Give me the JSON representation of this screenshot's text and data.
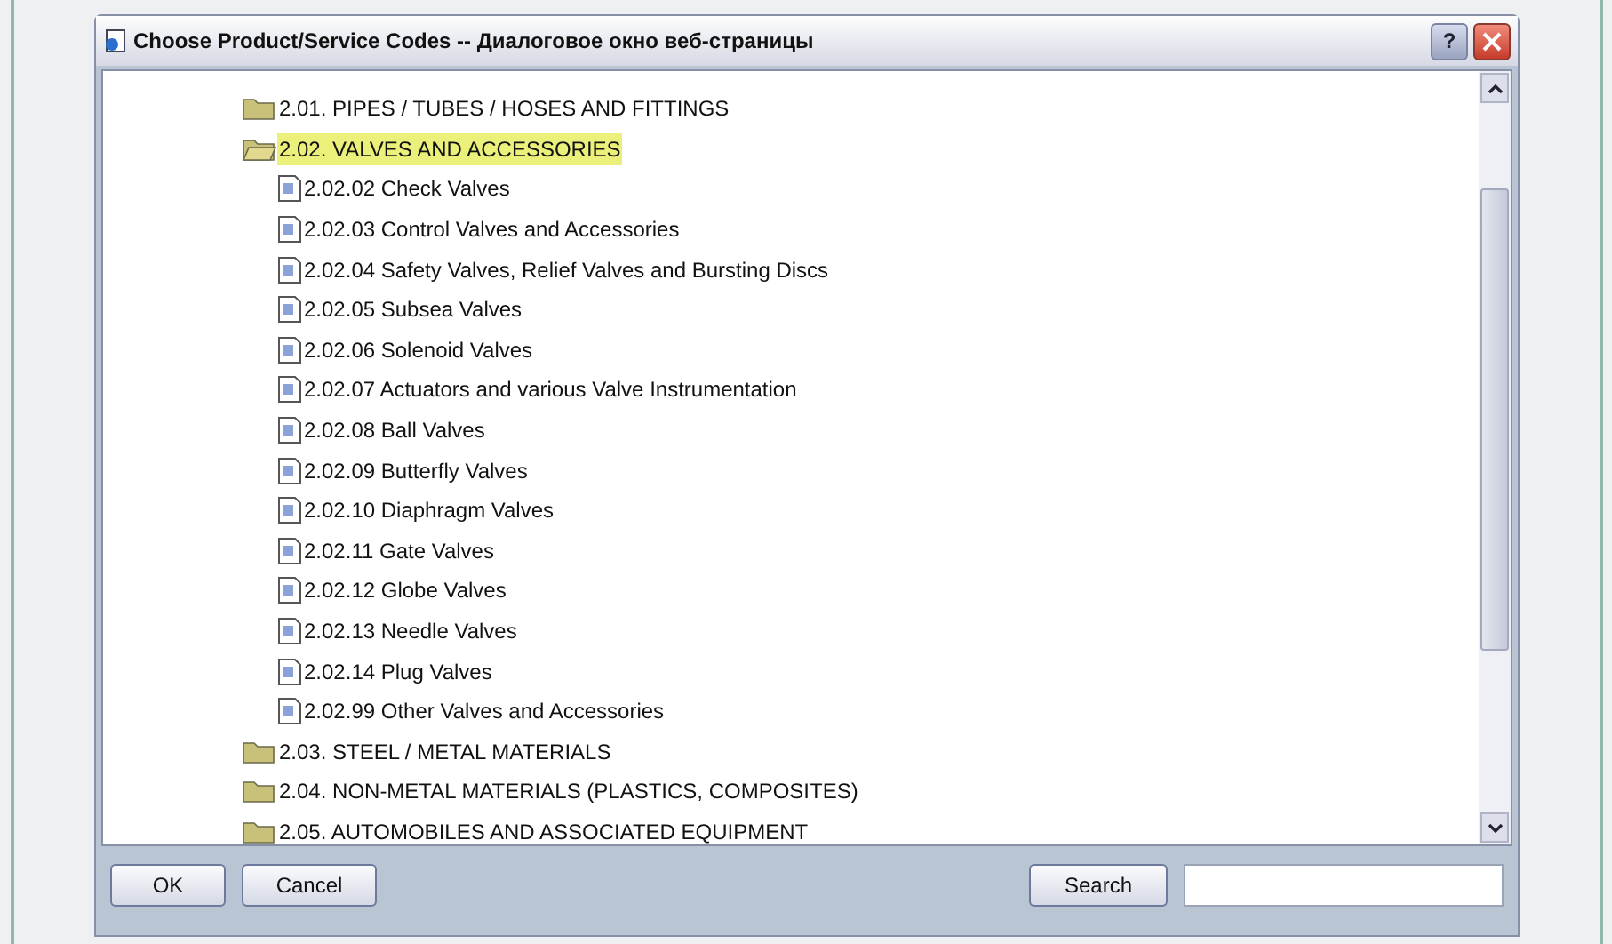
{
  "window": {
    "title": "Choose Product/Service Codes -- Диалоговое окно веб-страницы",
    "help": "?"
  },
  "tree": [
    {
      "label": "2.01. PIPES / TUBES / HOSES AND FITTINGS",
      "kind": "folder",
      "expanded": false,
      "selected": false
    },
    {
      "label": "2.02. VALVES AND ACCESSORIES",
      "kind": "folder",
      "expanded": true,
      "selected": true,
      "children": [
        {
          "label": "2.02.02 Check Valves",
          "kind": "doc",
          "selected": false
        },
        {
          "label": "2.02.03 Control Valves and Accessories",
          "kind": "doc",
          "selected": false
        },
        {
          "label": "2.02.04 Safety Valves, Relief Valves and Bursting Discs",
          "kind": "doc",
          "selected": false
        },
        {
          "label": "2.02.05 Subsea Valves",
          "kind": "doc",
          "selected": false
        },
        {
          "label": "2.02.06 Solenoid Valves",
          "kind": "doc",
          "selected": false
        },
        {
          "label": "2.02.07 Actuators and various Valve Instrumentation",
          "kind": "doc",
          "selected": false
        },
        {
          "label": "2.02.08 Ball Valves",
          "kind": "doc",
          "selected": false
        },
        {
          "label": "2.02.09 Butterfly Valves",
          "kind": "doc",
          "selected": false
        },
        {
          "label": "2.02.10 Diaphragm Valves",
          "kind": "doc",
          "selected": false
        },
        {
          "label": "2.02.11 Gate Valves",
          "kind": "doc",
          "selected": false
        },
        {
          "label": "2.02.12 Globe Valves",
          "kind": "doc",
          "selected": false
        },
        {
          "label": "2.02.13 Needle Valves",
          "kind": "doc",
          "selected": false
        },
        {
          "label": "2.02.14 Plug Valves",
          "kind": "doc",
          "selected": false
        },
        {
          "label": "2.02.99 Other Valves and Accessories",
          "kind": "doc",
          "selected": false
        }
      ]
    },
    {
      "label": "2.03. STEEL / METAL MATERIALS",
      "kind": "folder",
      "expanded": false,
      "selected": false
    },
    {
      "label": "2.04. NON-METAL MATERIALS (PLASTICS, COMPOSITES)",
      "kind": "folder",
      "expanded": false,
      "selected": false
    },
    {
      "label": "2.05. AUTOMOBILES AND ASSOCIATED EQUIPMENT",
      "kind": "folder",
      "expanded": false,
      "selected": false
    }
  ],
  "buttons": {
    "ok": "OK",
    "cancel": "Cancel",
    "search": "Search"
  }
}
